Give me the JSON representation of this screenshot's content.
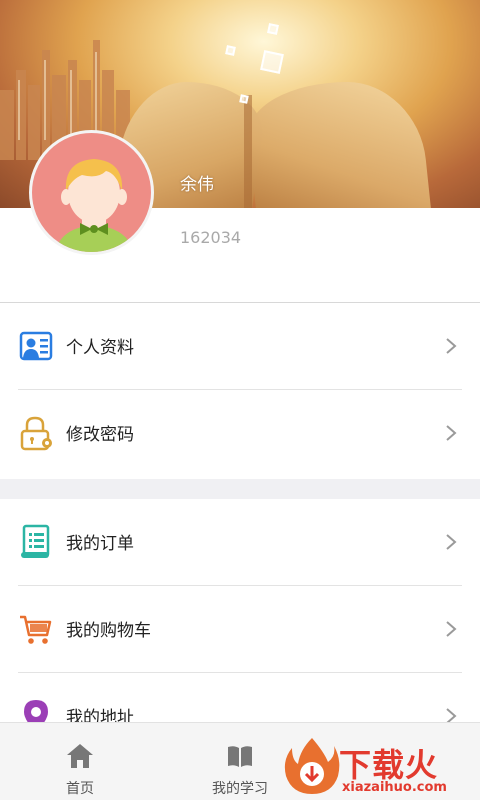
{
  "profile": {
    "name": "余伟",
    "id": "162034"
  },
  "groups": [
    {
      "items": [
        {
          "label": "个人资料",
          "icon": "id-card-icon"
        },
        {
          "label": "修改密码",
          "icon": "lock-gear-icon"
        }
      ]
    },
    {
      "items": [
        {
          "label": "我的订单",
          "icon": "order-list-icon"
        },
        {
          "label": "我的购物车",
          "icon": "shopping-cart-icon"
        },
        {
          "label": "我的地址",
          "icon": "location-pin-icon"
        }
      ]
    }
  ],
  "tabbar": {
    "tabs": [
      {
        "label": "首页",
        "icon": "home-icon"
      },
      {
        "label": "我的学习",
        "icon": "book-icon"
      }
    ]
  },
  "watermark": {
    "text": "下载火",
    "sub": "xiazaihuo.com"
  },
  "colors": {
    "accent_blue": "#2a7de1",
    "lock_gold": "#d9a33a",
    "order_teal": "#2bb5a4",
    "cart_orange": "#e8702f",
    "pin_purple": "#9b3fb6",
    "watermark_red": "#e23a2e"
  }
}
